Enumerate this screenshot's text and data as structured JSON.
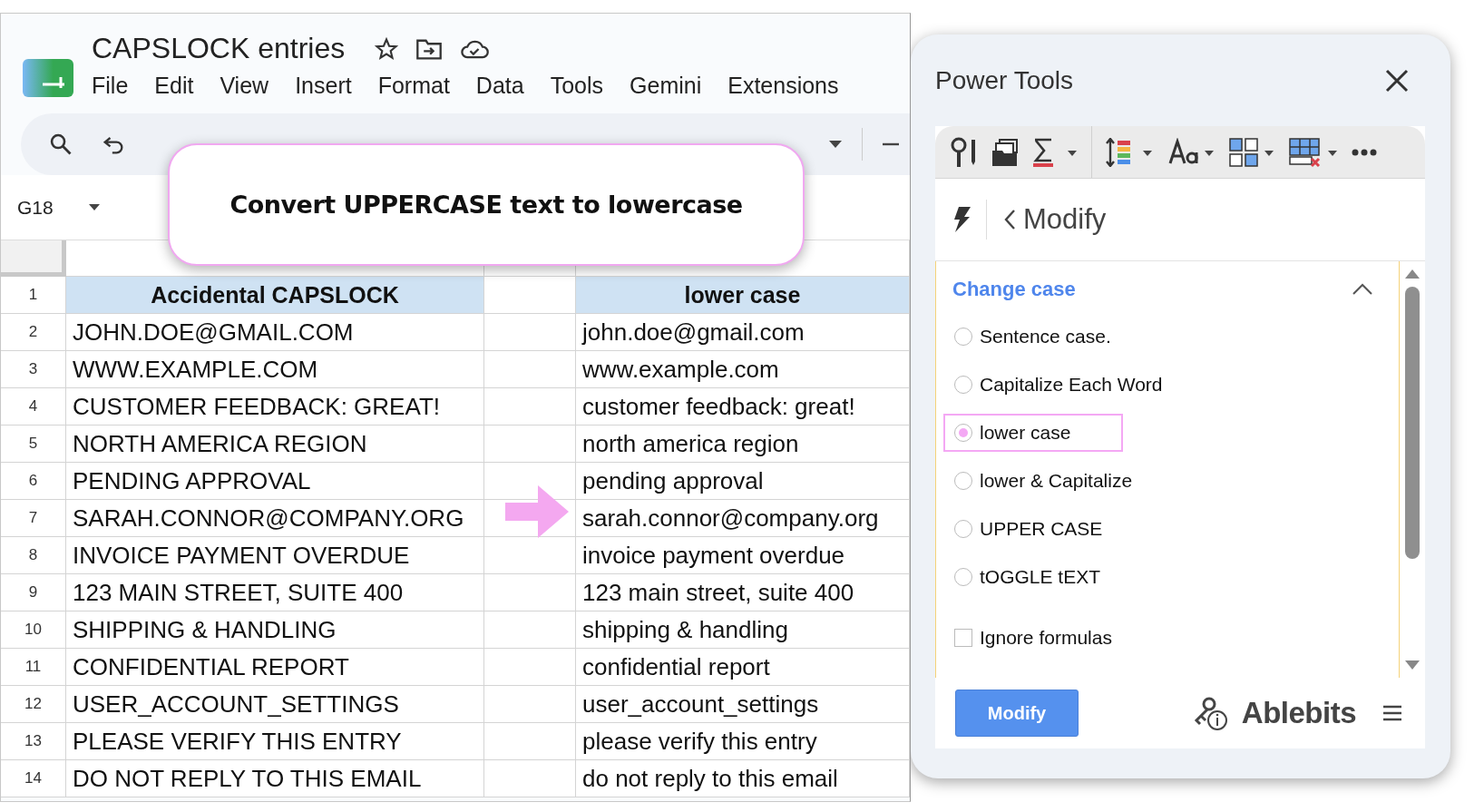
{
  "app": {
    "title": "CAPSLOCK entries",
    "menu": [
      "File",
      "Edit",
      "View",
      "Insert",
      "Format",
      "Data",
      "Tools",
      "Gemini",
      "Extensions"
    ]
  },
  "name_box": "G18",
  "callout": "Convert UPPERCASE text to lowercase",
  "sheet": {
    "header": {
      "number": "1",
      "column_a": "Accidental CAPSLOCK",
      "column_c": "lower case"
    },
    "rows": [
      {
        "number": "2",
        "original": "JOHN.DOE@GMAIL.COM",
        "converted": "john.doe@gmail.com"
      },
      {
        "number": "3",
        "original": "WWW.EXAMPLE.COM",
        "converted": "www.example.com"
      },
      {
        "number": "4",
        "original": "CUSTOMER FEEDBACK: GREAT!",
        "converted": "customer feedback: great!"
      },
      {
        "number": "5",
        "original": "NORTH AMERICA REGION",
        "converted": "north america region"
      },
      {
        "number": "6",
        "original": "PENDING APPROVAL",
        "converted": "pending approval"
      },
      {
        "number": "7",
        "original": "SARAH.CONNOR@COMPANY.ORG",
        "converted": "sarah.connor@company.org"
      },
      {
        "number": "8",
        "original": "INVOICE PAYMENT OVERDUE",
        "converted": "invoice payment overdue"
      },
      {
        "number": "9",
        "original": "123 MAIN STREET, SUITE 400",
        "converted": "123 main street, suite 400"
      },
      {
        "number": "10",
        "original": "SHIPPING & HANDLING",
        "converted": "shipping & handling"
      },
      {
        "number": "11",
        "original": "CONFIDENTIAL REPORT",
        "converted": "confidential report"
      },
      {
        "number": "12",
        "original": "USER_ACCOUNT_SETTINGS",
        "converted": "user_account_settings"
      },
      {
        "number": "13",
        "original": "PLEASE VERIFY THIS ENTRY",
        "converted": "please verify this entry"
      },
      {
        "number": "14",
        "original": "DO NOT REPLY TO THIS EMAIL",
        "converted": "do not reply to this email"
      }
    ]
  },
  "panel": {
    "title": "Power Tools",
    "breadcrumb": "Modify",
    "section": {
      "title": "Change case",
      "expanded": true,
      "options": [
        {
          "label": "Sentence case.",
          "selected": false
        },
        {
          "label": "Capitalize Each Word",
          "selected": false
        },
        {
          "label": "lower case",
          "selected": true
        },
        {
          "label": "lower & Capitalize",
          "selected": false
        },
        {
          "label": "UPPER CASE",
          "selected": false
        },
        {
          "label": "tOGGLE tEXT",
          "selected": false
        }
      ],
      "ignore_formulas": {
        "label": "Ignore formulas",
        "checked": false
      }
    },
    "button": "Modify",
    "brand": "Ablebits"
  }
}
